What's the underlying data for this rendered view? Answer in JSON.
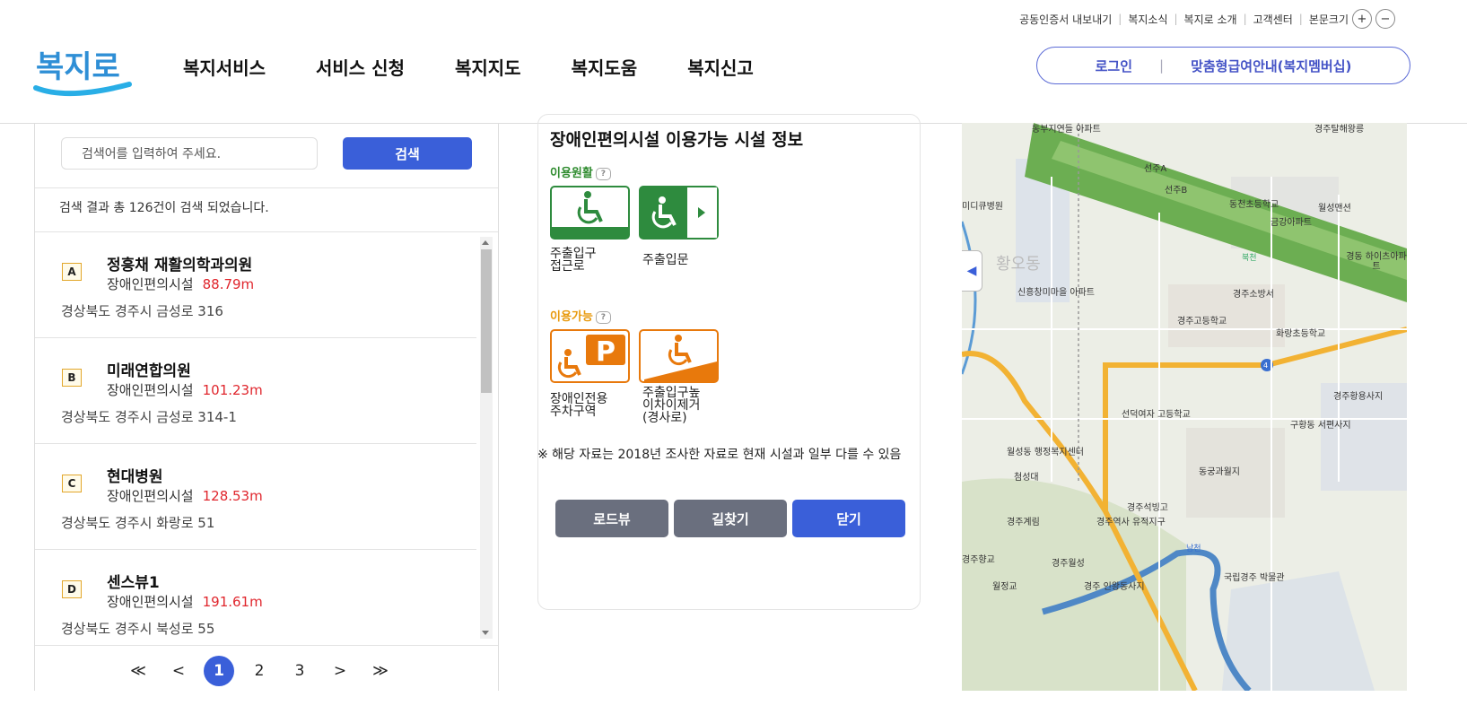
{
  "utility": {
    "links": [
      "공동인증서 내보내기",
      "복지소식",
      "복지로 소개",
      "고객센터",
      "본문크기"
    ],
    "zoom_in": "+",
    "zoom_out": "−"
  },
  "header": {
    "logo": "복지로",
    "nav": [
      "복지서비스",
      "서비스 신청",
      "복지지도",
      "복지도움",
      "복지신고"
    ],
    "login": "로그인",
    "membership": "맞춤형급여안내(복지멤버십)"
  },
  "search": {
    "placeholder": "검색어를 입력하여 주세요.",
    "button": "검색",
    "result_count": "검색 결과 총 126건이 검색 되었습니다."
  },
  "results": [
    {
      "marker": "A",
      "name": "정흥채 재활의학과의원",
      "type": "장애인편의시설",
      "distance": "88.79m",
      "address": "경상북도 경주시 금성로 316"
    },
    {
      "marker": "B",
      "name": "미래연합의원",
      "type": "장애인편의시설",
      "distance": "101.23m",
      "address": "경상북도 경주시 금성로 314-1"
    },
    {
      "marker": "C",
      "name": "현대병원",
      "type": "장애인편의시설",
      "distance": "128.53m",
      "address": "경상북도 경주시 화랑로 51"
    },
    {
      "marker": "D",
      "name": "센스뷰1",
      "type": "장애인편의시설",
      "distance": "191.61m",
      "address": "경상북도 경주시 북성로 55"
    }
  ],
  "pagination": {
    "first": "≪",
    "prev": "<",
    "pages": [
      "1",
      "2",
      "3"
    ],
    "current": "1",
    "next": ">",
    "last": "≫"
  },
  "detail": {
    "title": "장애인편의시설 이용가능 시설 정보",
    "smooth_label": "이용원활",
    "available_label": "이용가능",
    "smooth_items": [
      {
        "caption_1": "주출입구",
        "caption_2": "접근로"
      },
      {
        "caption_1": "주출입문",
        "caption_2": ""
      }
    ],
    "available_items": [
      {
        "caption_1": "장애인전용",
        "caption_2": "주차구역",
        "caption_3": ""
      },
      {
        "caption_1": "주출입구높",
        "caption_2": "이차이제거",
        "caption_3": "(경사로)"
      }
    ],
    "note": "※ 해당 자료는 2018년 조사한 자료로 현재 시설과 일부 다를 수 있음",
    "buttons": {
      "roadview": "로드뷰",
      "directions": "길찾기",
      "close": "닫기"
    }
  },
  "map": {
    "labels": [
      "동부지연들 아파트",
      "경주탈해왕릉",
      "선주A",
      "선주B",
      "동천초등학교",
      "월성맨션",
      "금강아파트",
      "미디큐병원",
      "황오동",
      "신흥창미마을 아파트",
      "경주소방서",
      "경동 하이츠아파트",
      "경주고등학교",
      "화랑초등학교",
      "경주황용사지",
      "선덕여자 고등학교",
      "월성동 행정복지센터",
      "구황동 서편사지",
      "동궁과월지",
      "경주석빙고",
      "경주계림",
      "경주역사 유적지구",
      "경주향교",
      "경주월성",
      "월정교",
      "경주 인왕동사지",
      "국립경주 박물관",
      "첨성대",
      "북천",
      "남천",
      "4"
    ],
    "colors": {
      "river": "#5b9bd5",
      "green_belt": "#6cae52",
      "road": "#f2b233"
    }
  }
}
